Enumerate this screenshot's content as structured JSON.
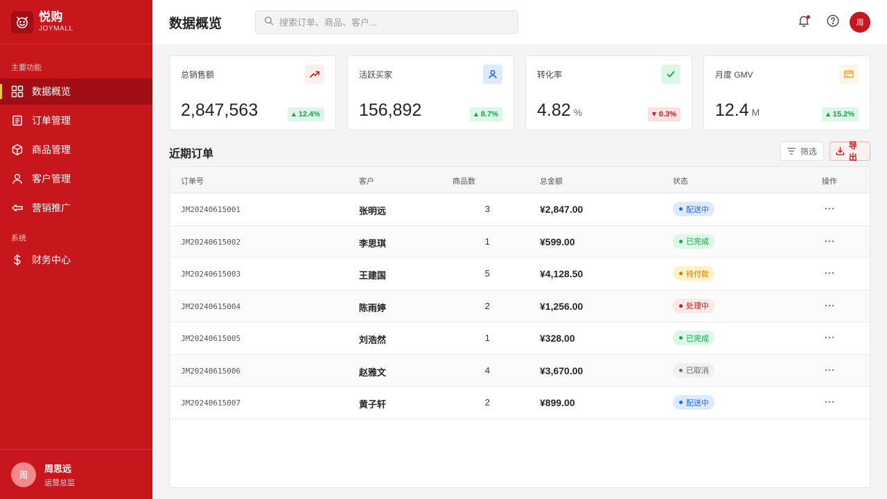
{
  "brand": {
    "name": "悦购",
    "sub": "JOYMALL",
    "logo_icon": "smile-logo-icon"
  },
  "sidebar": {
    "main_title": "主要功能",
    "items": [
      {
        "label": "数据概览",
        "icon": "grid-icon",
        "active": true
      },
      {
        "label": "订单管理",
        "icon": "order-icon",
        "active": false
      },
      {
        "label": "商品管理",
        "icon": "box-icon",
        "active": false
      },
      {
        "label": "客户管理",
        "icon": "user-icon",
        "active": false
      },
      {
        "label": "营销推广",
        "icon": "promo-icon",
        "active": false
      }
    ],
    "system_title": "系统",
    "system_items": [
      {
        "label": "财务中心",
        "icon": "dollar-icon",
        "active": false
      }
    ]
  },
  "user": {
    "avatar_text": "周",
    "name": "周思远",
    "role": "运营总监"
  },
  "header": {
    "title": "数据概览",
    "search_placeholder": "搜索订单、商品、客户...",
    "avatar_text": "周"
  },
  "stats": [
    {
      "label": "总销售额",
      "value": "2,847,563",
      "unit": "",
      "delta": "12.4%",
      "direction": "up",
      "icon": "trend-up-icon",
      "icon_bg": "#fdeeee",
      "icon_color": "#c8161d"
    },
    {
      "label": "活跃买家",
      "value": "156,892",
      "unit": "",
      "delta": "8.7%",
      "direction": "up",
      "icon": "user-icon",
      "icon_bg": "#dbeafe",
      "icon_color": "#2563eb"
    },
    {
      "label": "转化率",
      "value": "4.82",
      "unit": "%",
      "delta": "0.3%",
      "direction": "down",
      "icon": "check-icon",
      "icon_bg": "#dcf7e8",
      "icon_color": "#16a34a"
    },
    {
      "label": "月度 GMV",
      "value": "12.4",
      "unit": "M",
      "delta": "15.2%",
      "direction": "up",
      "icon": "card-icon",
      "icon_bg": "#fef6e4",
      "icon_color": "#e0a21a"
    }
  ],
  "orders": {
    "title": "近期订单",
    "filter_label": "筛选",
    "export_label": "导出",
    "columns": [
      "订单号",
      "客户",
      "商品数",
      "总金额",
      "状态",
      "操作"
    ],
    "rows": [
      {
        "id": "JM20240615001",
        "customer": "张明远",
        "qty": "3",
        "amount": "¥2,847.00",
        "status": "配送中",
        "status_type": "shipping"
      },
      {
        "id": "JM20240615002",
        "customer": "李思琪",
        "qty": "1",
        "amount": "¥599.00",
        "status": "已完成",
        "status_type": "done"
      },
      {
        "id": "JM20240615003",
        "customer": "王建国",
        "qty": "5",
        "amount": "¥4,128.50",
        "status": "待付款",
        "status_type": "pending"
      },
      {
        "id": "JM20240615004",
        "customer": "陈雨婷",
        "qty": "2",
        "amount": "¥1,256.00",
        "status": "处理中",
        "status_type": "processing"
      },
      {
        "id": "JM20240615005",
        "customer": "刘浩然",
        "qty": "1",
        "amount": "¥328.00",
        "status": "已完成",
        "status_type": "done"
      },
      {
        "id": "JM20240615006",
        "customer": "赵雅文",
        "qty": "4",
        "amount": "¥3,670.00",
        "status": "已取消",
        "status_type": "cancelled"
      },
      {
        "id": "JM20240615007",
        "customer": "黄子轩",
        "qty": "2",
        "amount": "¥899.00",
        "status": "配送中",
        "status_type": "shipping"
      }
    ]
  },
  "colors": {
    "brand": "#c8161d",
    "brand_dark": "#a10f15",
    "accent": "#f5c24a",
    "status": {
      "shipping": {
        "bg": "#dbeafe",
        "fg": "#2563eb"
      },
      "done": {
        "bg": "#dcf7e8",
        "fg": "#16a34a"
      },
      "pending": {
        "bg": "#fef3c7",
        "fg": "#d97706"
      },
      "processing": {
        "bg": "#fde7e8",
        "fg": "#c8161d"
      },
      "cancelled": {
        "bg": "#f0f0f1",
        "fg": "#6b6b70"
      }
    }
  }
}
